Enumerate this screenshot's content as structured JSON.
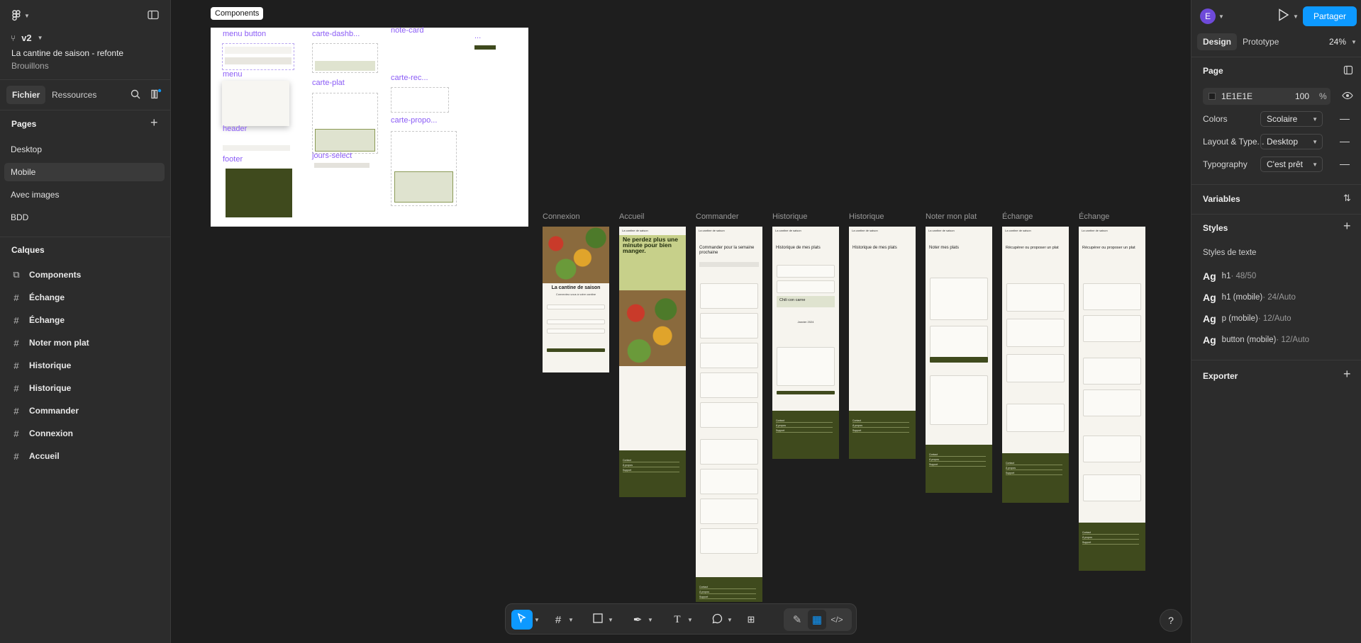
{
  "left_panel": {
    "version": "v2",
    "file_name": "La cantine de saison - refonte",
    "project": "Brouillons",
    "tabs": [
      "Fichier",
      "Ressources"
    ],
    "pages_title": "Pages",
    "pages": [
      "Desktop",
      "Mobile",
      "Avec images",
      "BDD"
    ],
    "active_page": "Mobile",
    "layers_title": "Calques",
    "layers": [
      {
        "label": "Components",
        "icon": "component-set-icon"
      },
      {
        "label": "Échange",
        "icon": "frame-icon"
      },
      {
        "label": "Échange",
        "icon": "frame-icon"
      },
      {
        "label": "Noter mon plat",
        "icon": "frame-icon"
      },
      {
        "label": "Historique",
        "icon": "frame-icon"
      },
      {
        "label": "Historique",
        "icon": "frame-icon"
      },
      {
        "label": "Commander",
        "icon": "frame-icon"
      },
      {
        "label": "Connexion",
        "icon": "frame-icon"
      },
      {
        "label": "Accueil",
        "icon": "frame-icon"
      }
    ]
  },
  "canvas": {
    "components_badge": "Components",
    "component_labels": [
      "menu button",
      "carte-dashb...",
      "note-card",
      "menu",
      "carte-plat",
      "carte-rec...",
      "header",
      "carte-propo...",
      "footer",
      "jours-select",
      "..."
    ],
    "frame_labels": [
      "Connexion",
      "Accueil",
      "Commander",
      "Historique",
      "Historique",
      "Noter mon plat",
      "Échange",
      "Échange"
    ],
    "mock_text": {
      "brand": "La cantine de saison",
      "connexion_title": "La cantine de saison",
      "connexion_sub": "Connectez-vous à votre cantine",
      "accueil_hero": "Ne perdez plus une minute pour bien manger.",
      "commander_title": "Commander pour la semaine prochaine",
      "historique_title": "Historique de mes plats",
      "noter_title": "Noter mes plats",
      "echange_title": "Récupérer ou proposer un plat",
      "chili": "Chili con carne",
      "month": "Janvier 2024",
      "footer_links": [
        "Contact",
        "À propos",
        "Support"
      ]
    }
  },
  "toolbar": {
    "tools": [
      "move-tool",
      "frame-tool",
      "shape-tool",
      "pen-tool",
      "text-tool",
      "comment-tool",
      "actions-tool"
    ],
    "modes": [
      "draw-mode",
      "design-mode",
      "dev-mode"
    ],
    "help": "?"
  },
  "right_panel": {
    "avatar": "E",
    "share_label": "Partager",
    "tabs": [
      "Design",
      "Prototype"
    ],
    "zoom": "24%",
    "page_section": "Page",
    "page_color": "1E1E1E",
    "page_opacity": "100",
    "percent": "%",
    "modes": [
      {
        "label": "Colors",
        "value": "Scolaire"
      },
      {
        "label": "Layout & Type...",
        "value": "Desktop"
      },
      {
        "label": "Typography",
        "value": "C'est prêt"
      }
    ],
    "variables": "Variables",
    "styles": "Styles",
    "text_styles_title": "Styles de texte",
    "text_styles": [
      {
        "name": "h1",
        "detail": " · 48/50"
      },
      {
        "name": "h1 (mobile)",
        "detail": " · 24/Auto"
      },
      {
        "name": "p (mobile)",
        "detail": " · 12/Auto"
      },
      {
        "name": "button (mobile)",
        "detail": " · 12/Auto"
      }
    ],
    "ag": "Ag",
    "export": "Exporter"
  },
  "colors": {
    "accent": "#0d99ff",
    "footer_green": "#3f4a1d",
    "component_purple": "#8b5cf6",
    "canvas": "#1e1e1e",
    "panel": "#2c2c2c"
  }
}
